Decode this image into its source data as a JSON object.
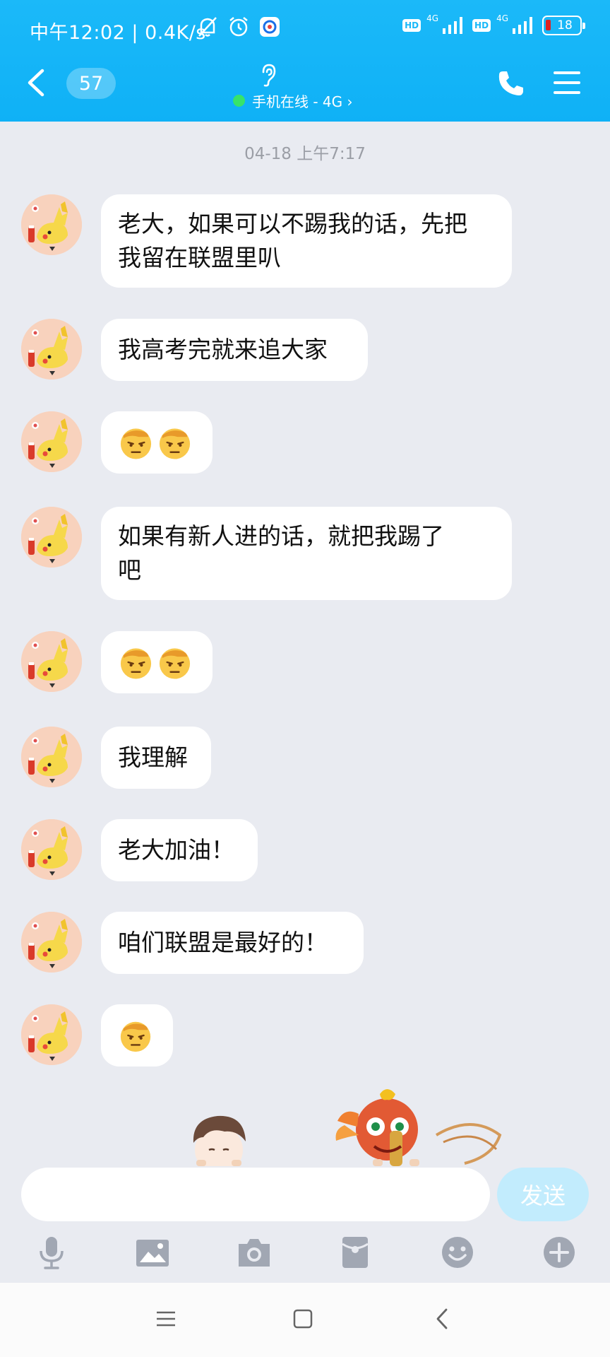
{
  "status_bar": {
    "time": "中午12:02 | 0.4K/s",
    "net1": "4G",
    "net2": "4G",
    "hd": "HD",
    "battery": "18"
  },
  "header": {
    "unread_count": "57",
    "online_status": "手机在线 - 4G ›"
  },
  "chat": {
    "timestamp": "04-18 上午7:17",
    "messages": [
      {
        "type": "text",
        "text": "老大，如果可以不踢我的话，先把\n我留在联盟里叭"
      },
      {
        "type": "text",
        "text": "我高考完就来追大家"
      },
      {
        "type": "emoji",
        "emoji": "salute-emoji",
        "count": 2
      },
      {
        "type": "text",
        "text": "如果有新人进的话，就把我踢了\n吧"
      },
      {
        "type": "emoji",
        "emoji": "salute-emoji",
        "count": 2
      },
      {
        "type": "text",
        "text": "我理解"
      },
      {
        "type": "text",
        "text": "老大加油！"
      },
      {
        "type": "text",
        "text": "咱们联盟是最好的！"
      },
      {
        "type": "emoji",
        "emoji": "salute-emoji",
        "count": 1
      }
    ]
  },
  "input": {
    "placeholder": "",
    "send_label": "发送"
  },
  "toolbar": [
    "mic-icon",
    "image-icon",
    "camera-icon",
    "red-packet-icon",
    "emoji-icon",
    "plus-icon"
  ],
  "colors": {
    "header": "#1bb9f9",
    "background": "#e9ebf1",
    "bubble": "#ffffff",
    "send_button": "#c2ecfd",
    "online_dot": "#37e36a"
  }
}
